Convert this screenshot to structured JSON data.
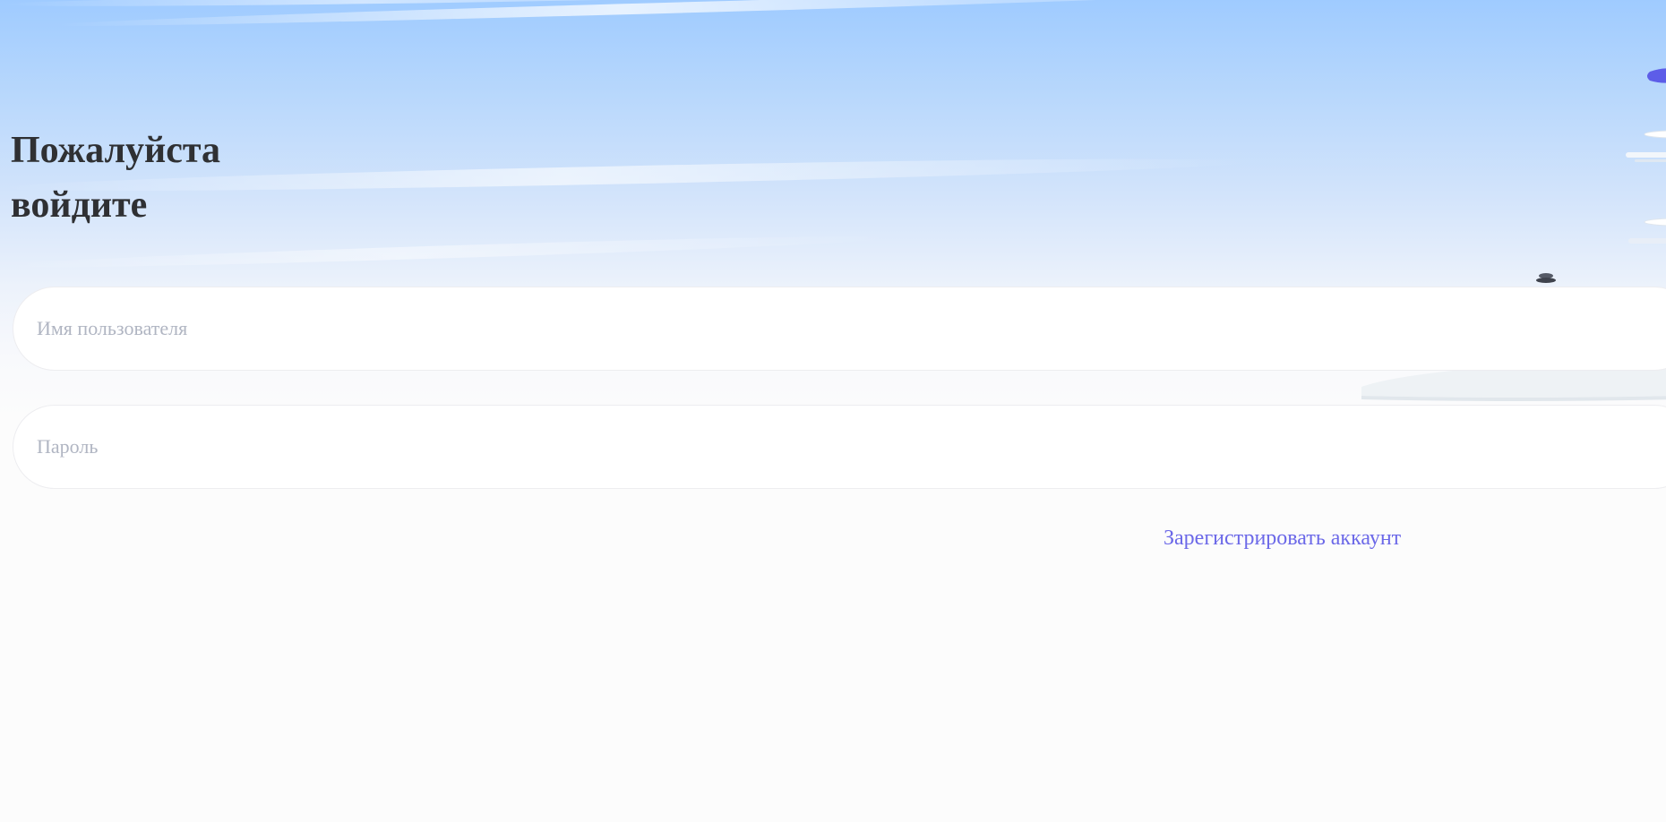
{
  "login": {
    "title_line1": "Пожалуйста",
    "title_line2": "войдите",
    "username_placeholder": "Имя пользователя",
    "username_value": "",
    "password_placeholder": "Пароль",
    "password_value": "",
    "register_link": "Зарегистрировать аккаунт"
  },
  "colors": {
    "accent": "#6b68e8",
    "heading": "#2f3033",
    "placeholder": "#b0b5c2",
    "sky_top": "#9fcbff"
  },
  "illustration": {
    "icon": "desk-lamp-illustration"
  }
}
